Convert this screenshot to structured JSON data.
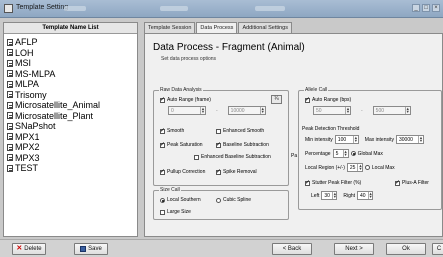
{
  "window": {
    "title": "Template Setting"
  },
  "left_panel": {
    "header": "Template Name List",
    "items": [
      "AFLP",
      "LOH",
      "MSI",
      "MS-MLPA",
      "MLPA",
      "Trisomy",
      "Microsatellite_Animal",
      "Microsatellite_Plant",
      "SNaPshot",
      "MPX1",
      "MPX2",
      "MPX3",
      "TEST"
    ],
    "delete_label": "Delete",
    "save_label": "Save"
  },
  "tabs": [
    "Template Session",
    "Data Process",
    "Additional Settings"
  ],
  "active_tab": "Data Process",
  "panel": {
    "title": "Data Process - Fragment (Animal)",
    "subtitle": "Set data process options"
  },
  "raw": {
    "label": "Raw Data Analysis",
    "auto_range": "Auto Range (frame)",
    "range_from": "0",
    "range_to": "10000",
    "smooth": "Smooth",
    "enhanced_smooth": "Enhanced Smooth",
    "peak_saturation": "Peak Saturation",
    "baseline_subtraction": "Baseline Subtraction",
    "enhanced_baseline": "Enhanced Baseline Subtraction",
    "pullup": "Pullup Correction",
    "spike": "Spike Removal",
    "side_text": "Pa"
  },
  "size_call": {
    "label": "Size Call",
    "local_southern": "Local Southern",
    "cubic_spline": "Cubic Spline",
    "large_size": "Large Size"
  },
  "allele": {
    "label": "Allele Call",
    "auto_range": "Auto Range (bps)",
    "range_from": "50",
    "range_to": "500",
    "peak_threshold": "Peak Detection Threshold",
    "min_intensity_label": "Min intensity",
    "min_intensity": "100",
    "max_intensity_label": "Max intensity",
    "max_intensity": "30000",
    "percentage_label": "Percentage",
    "percentage": "5",
    "global_max": "Global Max",
    "local_region_label": "Local Region (+/-)",
    "local_region": "25",
    "local_max": "Local Max",
    "stutter": "Stutter Peak Filter (%)",
    "plusA": "Plus-A Filter",
    "left_label": "Left",
    "left_val": "30",
    "right_label": "Right",
    "right_val": "40"
  },
  "buttons": {
    "back": "< Back",
    "next": "Next >",
    "ok": "Ok",
    "cancel": "C"
  }
}
